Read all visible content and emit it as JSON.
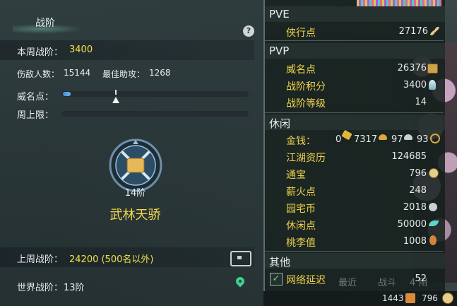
{
  "left": {
    "title": "战阶",
    "help_label": "?",
    "weekly_label": "本周战阶：",
    "weekly_value": "3400",
    "kills_label": "伤敌人数：",
    "kills_value": "15144",
    "assist_label": "最佳助攻：",
    "assist_value": "1268",
    "prestige_label": "威名点：",
    "prestige_fill": 0.04,
    "cap_label": "周上限：",
    "rank_number": "14阶",
    "rank_title": "武林天骄",
    "last_week_label": "上周战阶：",
    "last_week_value": "24200 (500名以外)",
    "world_label": "世界战阶：",
    "world_value": "13阶"
  },
  "right": {
    "pve_header": "PVE",
    "pvp_header": "PVP",
    "leisure_header": "休闲",
    "other_header": "其他",
    "pve_items": [
      {
        "label": "侠行点",
        "value": "27176",
        "icon": "brush-icon"
      }
    ],
    "pvp_items": [
      {
        "label": "威名点",
        "value": "26376",
        "icon": "badge-icon"
      },
      {
        "label": "战阶积分",
        "value": "3400",
        "icon": "crystal-icon"
      },
      {
        "label": "战阶等级",
        "value": "14"
      }
    ],
    "money": {
      "label": "金钱：",
      "gold_bar": "0",
      "gold": "7317",
      "silver": "97",
      "copper": "93"
    },
    "leisure_items": [
      {
        "label": "江湖资历",
        "value": "124685"
      },
      {
        "label": "通宝",
        "value": "796",
        "icon": "coin-icon"
      },
      {
        "label": "薪火点",
        "value": "248"
      },
      {
        "label": "园宅币",
        "value": "2018",
        "icon": "home-coin-icon"
      },
      {
        "label": "休闲点",
        "value": "50000",
        "icon": "leaf-icon"
      },
      {
        "label": "桃李值",
        "value": "1008",
        "icon": "gourd-icon"
      }
    ],
    "other_items": [
      {
        "label": "网络延迟",
        "value": "52"
      }
    ],
    "behind_text": [
      "最近",
      "战斗",
      "4 用"
    ]
  },
  "footer": {
    "value1": "1443",
    "value2": "796"
  },
  "colors": {
    "accent_yellow": "#f1e049",
    "item_gold": "#f0d24a",
    "bar_blue": "#4a9be0",
    "panel": "#2b3a3b"
  }
}
